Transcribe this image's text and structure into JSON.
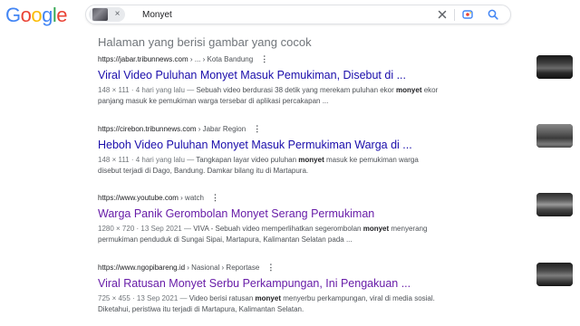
{
  "logo": {
    "letters": [
      "G",
      "o",
      "o",
      "g",
      "l",
      "e"
    ],
    "colors": [
      "#4285F4",
      "#EA4335",
      "#FBBC05",
      "#4285F4",
      "#34A853",
      "#EA4335"
    ]
  },
  "search": {
    "query": "Monyet",
    "chip_close": "×",
    "clear_icon": "x-icon",
    "lens_icon": "lens-icon",
    "search_icon": "search-icon"
  },
  "section_heading": "Halaman yang berisi gambar yang cocok",
  "results": [
    {
      "url": "https://jabar.tribunnews.com",
      "crumb": " › ... › Kota Bandung",
      "title": "Viral Video Puluhan Monyet Masuk Pemukiman, Disebut di ...",
      "meta": "148 × 111 · 4 hari yang lalu — ",
      "snippet_pre": "Sebuah video berdurasi 38 detik yang merekam puluhan ekor ",
      "snippet_bold": "monyet",
      "snippet_post": " ekor panjang masuk ke pemukiman warga tersebar di aplikasi percakapan ...",
      "visited": false
    },
    {
      "url": "https://cirebon.tribunnews.com",
      "crumb": " › Jabar Region",
      "title": "Heboh Video Puluhan Monyet Masuk Permukiman Warga di ...",
      "meta": "148 × 111 · 4 hari yang lalu — ",
      "snippet_pre": "Tangkapan layar video puluhan ",
      "snippet_bold": "monyet",
      "snippet_post": " masuk ke pemukiman warga disebut terjadi di Dago, Bandung. Damkar bilang itu di Martapura.",
      "visited": false
    },
    {
      "url": "https://www.youtube.com",
      "crumb": " › watch",
      "title": "Warga Panik Gerombolan Monyet Serang Permukiman",
      "meta": "1280 × 720 · 13 Sep 2021 — ",
      "snippet_pre": "VIVA - Sebuah video memperlihatkan segerombolan ",
      "snippet_bold": "monyet",
      "snippet_post": " menyerang permukiman penduduk di Sungai Sipai, Martapura, Kalimantan Selatan pada ...",
      "visited": true
    },
    {
      "url": "https://www.ngopibareng.id",
      "crumb": " › Nasional › Reportase",
      "title": "Viral Ratusan Monyet Serbu Perkampungan, Ini Pengakuan ...",
      "meta": "725 × 455 · 13 Sep 2021 — ",
      "snippet_pre": "Video berisi ratusan ",
      "snippet_bold": "monyet",
      "snippet_post": " menyerbu perkampungan, viral di media sosial. Diketahui, peristiwa itu terjadi di Martapura, Kalimantan Selatan.",
      "visited": true
    }
  ]
}
